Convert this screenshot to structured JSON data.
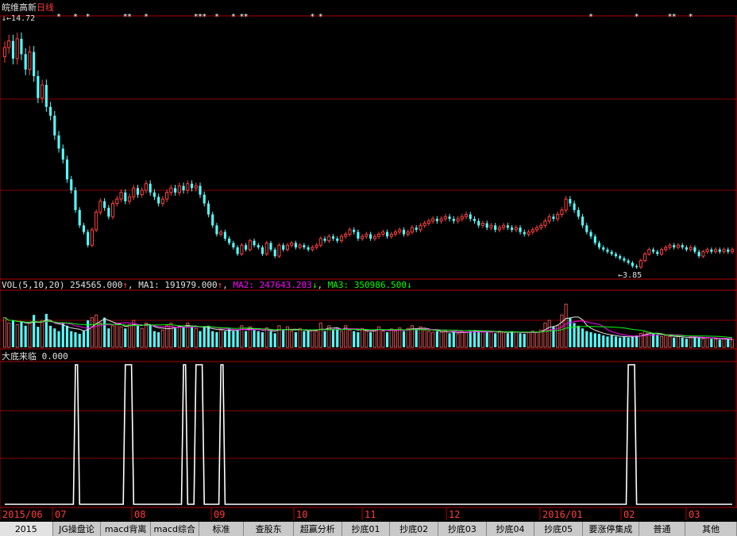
{
  "chart_title": {
    "stock": "皖维高新",
    "period": "日线"
  },
  "price_panel": {
    "high_label": "14.72",
    "low_label": "3.85"
  },
  "vol_panel": {
    "label": "VOL(5,10,20)",
    "value": "254565.000",
    "ma1_label": "MA1:",
    "ma1_value": "191979.000",
    "ma2_label": "MA2:",
    "ma2_value": "247643.203",
    "ma3_label": "MA3:",
    "ma3_value": "350986.500",
    "up_arrow": "↑",
    "down_arrow": "↓",
    "colors": {
      "up": "#ff4040",
      "ma2": "#ff00ff",
      "ma3": "#00ff00",
      "bar_up": "#d45050",
      "bar_down": "#54ffff"
    }
  },
  "indicator_panel": {
    "label": "大底来临",
    "value": "0.000"
  },
  "date_axis": [
    "2015/06",
    "07",
    "08",
    "09",
    "10",
    "11",
    "12",
    "2016/01",
    "02",
    "03"
  ],
  "bottom_tabs": [
    "2015",
    "JG操盘论",
    "macd背离",
    "macd综合",
    "标准",
    "查股东",
    "超赢分析",
    "抄底01",
    "抄底02",
    "抄底03",
    "抄底04",
    "抄底05",
    "要涨停集成",
    "普通",
    "其他"
  ],
  "colors": {
    "candle_up": "#ff4040",
    "candle_down": "#54ffff",
    "grid": "#8b0000",
    "axis_text": "#ff3c3c"
  },
  "chart_data": [
    {
      "type": "candlestick",
      "title": "皖维高新 日线",
      "period_start": "2015/06",
      "period_end": "2016/03",
      "close": [
        13.9,
        14.2,
        13.4,
        14.3,
        13.6,
        12.9,
        13.7,
        12.6,
        11.6,
        12.2,
        11.2,
        10.8,
        9.9,
        9.3,
        8.8,
        7.9,
        7.4,
        6.5,
        5.8,
        5.5,
        4.9,
        5.6,
        6.4,
        6.9,
        6.6,
        6.2,
        6.8,
        7.0,
        7.3,
        6.9,
        7.1,
        7.5,
        7.2,
        7.4,
        7.7,
        7.3,
        7.1,
        6.8,
        7.0,
        7.3,
        7.5,
        7.3,
        7.6,
        7.4,
        7.7,
        7.5,
        7.6,
        7.2,
        6.8,
        6.3,
        5.8,
        5.4,
        5.5,
        5.2,
        5.0,
        4.8,
        4.5,
        4.9,
        4.7,
        5.1,
        4.9,
        4.8,
        4.5,
        5.0,
        4.7,
        4.4,
        4.9,
        4.7,
        4.9,
        5.0,
        4.8,
        4.9,
        4.8,
        4.7,
        4.8,
        4.9,
        5.2,
        5.1,
        5.3,
        5.2,
        5.1,
        5.3,
        5.4,
        5.6,
        5.5,
        5.2,
        5.3,
        5.4,
        5.2,
        5.3,
        5.4,
        5.5,
        5.3,
        5.4,
        5.5,
        5.6,
        5.4,
        5.5,
        5.7,
        5.6,
        5.8,
        5.9,
        6.0,
        6.1,
        6.0,
        6.1,
        6.2,
        6.1,
        6.0,
        6.1,
        6.2,
        6.3,
        6.1,
        6.0,
        5.8,
        5.9,
        5.7,
        5.8,
        5.6,
        5.7,
        5.8,
        5.7,
        5.6,
        5.7,
        5.5,
        5.4,
        5.5,
        5.6,
        5.7,
        5.8,
        6.0,
        6.2,
        6.1,
        6.3,
        6.5,
        7.0,
        6.8,
        6.5,
        6.2,
        5.8,
        5.5,
        5.3,
        5.0,
        4.8,
        4.7,
        4.6,
        4.5,
        4.4,
        4.3,
        4.2,
        4.1,
        3.95,
        3.9,
        4.2,
        4.5,
        4.7,
        4.6,
        4.5,
        4.7,
        4.8,
        4.9,
        4.8,
        4.9,
        4.8,
        4.7,
        4.8,
        4.6,
        4.4,
        4.6,
        4.7,
        4.6,
        4.7,
        4.6,
        4.7,
        4.6,
        4.7
      ],
      "volume_scale": "relative 0-1",
      "volume": [
        0.55,
        0.45,
        0.5,
        0.42,
        0.48,
        0.4,
        0.45,
        0.6,
        0.38,
        0.5,
        0.62,
        0.4,
        0.35,
        0.3,
        0.45,
        0.4,
        0.3,
        0.28,
        0.25,
        0.3,
        0.5,
        0.55,
        0.6,
        0.45,
        0.55,
        0.35,
        0.4,
        0.45,
        0.38,
        0.35,
        0.42,
        0.5,
        0.4,
        0.35,
        0.45,
        0.42,
        0.3,
        0.28,
        0.32,
        0.4,
        0.45,
        0.35,
        0.4,
        0.38,
        0.45,
        0.4,
        0.35,
        0.3,
        0.38,
        0.4,
        0.3,
        0.28,
        0.32,
        0.3,
        0.35,
        0.3,
        0.32,
        0.4,
        0.3,
        0.38,
        0.32,
        0.3,
        0.28,
        0.36,
        0.3,
        0.26,
        0.4,
        0.32,
        0.38,
        0.3,
        0.28,
        0.35,
        0.3,
        0.3,
        0.32,
        0.3,
        0.45,
        0.3,
        0.4,
        0.32,
        0.35,
        0.3,
        0.4,
        0.32,
        0.3,
        0.28,
        0.35,
        0.3,
        0.28,
        0.32,
        0.38,
        0.3,
        0.28,
        0.34,
        0.3,
        0.36,
        0.3,
        0.35,
        0.4,
        0.32,
        0.38,
        0.32,
        0.3,
        0.28,
        0.3,
        0.28,
        0.3,
        0.26,
        0.28,
        0.25,
        0.3,
        0.28,
        0.3,
        0.32,
        0.3,
        0.28,
        0.3,
        0.28,
        0.26,
        0.3,
        0.28,
        0.26,
        0.3,
        0.28,
        0.26,
        0.25,
        0.28,
        0.3,
        0.28,
        0.32,
        0.45,
        0.5,
        0.38,
        0.4,
        0.6,
        0.8,
        0.55,
        0.45,
        0.4,
        0.35,
        0.3,
        0.28,
        0.26,
        0.25,
        0.22,
        0.2,
        0.22,
        0.2,
        0.18,
        0.2,
        0.18,
        0.2,
        0.22,
        0.26,
        0.3,
        0.28,
        0.25,
        0.22,
        0.2,
        0.22,
        0.2,
        0.18,
        0.2,
        0.18,
        0.16,
        0.18,
        0.2,
        0.18,
        0.16,
        0.18,
        0.16,
        0.15,
        0.14,
        0.16,
        0.15,
        0.14
      ],
      "ylabel": "",
      "annotations": {
        "max": 14.72,
        "min": 3.85
      }
    },
    {
      "type": "line",
      "title": "大底来临",
      "signal_ranges_bar_index": [
        [
          17,
          17
        ],
        [
          29,
          30
        ],
        [
          43,
          43
        ],
        [
          46,
          47
        ],
        [
          52,
          52
        ],
        [
          150,
          151
        ]
      ],
      "y_values": [
        0,
        1
      ]
    }
  ]
}
